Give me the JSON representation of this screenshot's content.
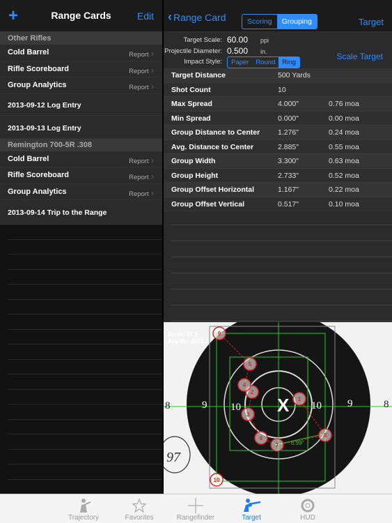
{
  "left": {
    "add_label": "+",
    "title": "Range Cards",
    "edit_label": "Edit",
    "sections": [
      {
        "header": "Other Rifles",
        "items": [
          {
            "label": "Cold Barrel",
            "report": "Report"
          },
          {
            "label": "Rifle Scoreboard",
            "report": "Report"
          },
          {
            "label": "Group Analytics",
            "report": "Report"
          },
          {
            "label": "2013-09-12 Log Entry",
            "report": ""
          },
          {
            "label": "2013-09-13 Log Entry",
            "report": ""
          }
        ]
      },
      {
        "header": "Remington 700-5R .308",
        "items": [
          {
            "label": "Cold Barrel",
            "report": "Report"
          },
          {
            "label": "Rifle Scoreboard",
            "report": "Report"
          },
          {
            "label": "Group Analytics",
            "report": "Report"
          },
          {
            "label": "2013-09-14 Trip to the Range",
            "report": ""
          }
        ]
      }
    ]
  },
  "nav": {
    "back_label": "Range Card",
    "seg_scoring": "Scoring",
    "seg_grouping": "Grouping",
    "target_label": "Target"
  },
  "scale": {
    "target_scale_label": "Target Scale:",
    "target_scale_value": "60.00",
    "target_scale_unit": "ppi",
    "projectile_label": "Projectile Diameter:",
    "projectile_value": "0.500",
    "projectile_unit": "in.",
    "impact_label": "Impact Style:",
    "impact_options": [
      "Paper",
      "Round",
      "Ring"
    ],
    "scale_target_label": "Scale Target"
  },
  "stats": [
    {
      "k": "Target Distance",
      "v1": "500 Yards",
      "v2": ""
    },
    {
      "k": "Shot Count",
      "v1": "10",
      "v2": ""
    },
    {
      "k": "Max Spread",
      "v1": "4.000\"",
      "v2": "0.76 moa"
    },
    {
      "k": "Min Spread",
      "v1": "0.000\"",
      "v2": "0.00 moa"
    },
    {
      "k": "Group Distance to Center",
      "v1": "1.276\"",
      "v2": "0.24 moa"
    },
    {
      "k": "Avg. Distance to Center",
      "v1": "2.885\"",
      "v2": "0.55 moa"
    },
    {
      "k": "Group Width",
      "v1": "3.300\"",
      "v2": "0.63 moa"
    },
    {
      "k": "Group Height",
      "v1": "2.733\"",
      "v2": "0.52 moa"
    },
    {
      "k": "Group Offset Horizontal",
      "v1": "1.167\"",
      "v2": "0.22 moa"
    },
    {
      "k": "Group Offset Vertical",
      "v1": "0.517\"",
      "v2": "0.10 moa"
    }
  ],
  "target": {
    "score": "Score: 97.3",
    "avg_vel": "Avg Vel: 2622.3",
    "center_mark": "X",
    "ring_10": "10",
    "ring_9": "9",
    "ring_8": "8",
    "spread_label": "0.99\"",
    "handwritten": "97",
    "shots": [
      "1",
      "2",
      "3",
      "4",
      "5",
      "6",
      "7",
      "8",
      "9",
      "10"
    ]
  },
  "tabs": [
    {
      "label": "Trajectory",
      "icon": "rifleman-icon"
    },
    {
      "label": "Favorites",
      "icon": "star-icon"
    },
    {
      "label": "Rangefinder",
      "icon": "crosshair-icon"
    },
    {
      "label": "Target",
      "icon": "shooter-icon"
    },
    {
      "label": "HUD",
      "icon": "reticle-icon"
    }
  ],
  "colors": {
    "accent": "#2f8cff",
    "active_tab": "#1f7cf2",
    "overlay_red": "#e02020",
    "overlay_green": "#22cc22"
  }
}
